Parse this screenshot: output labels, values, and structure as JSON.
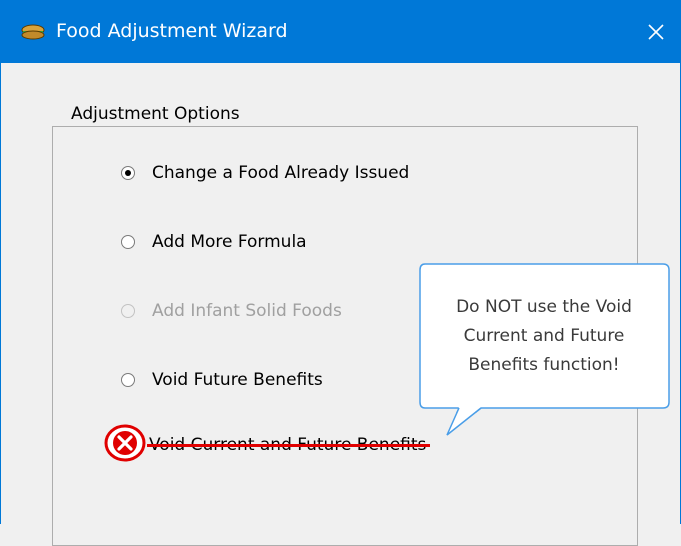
{
  "window": {
    "title": "Food Adjustment Wizard",
    "close_glyph": "✕",
    "icon": "app-icon"
  },
  "group": {
    "legend": "Adjustment Options"
  },
  "options": [
    {
      "label": "Change a Food Already Issued",
      "checked": true,
      "enabled": true
    },
    {
      "label": "Add More Formula",
      "checked": false,
      "enabled": true
    },
    {
      "label": "Add Infant Solid Foods",
      "checked": false,
      "enabled": false
    },
    {
      "label": "Void Future Benefits",
      "checked": false,
      "enabled": true
    }
  ],
  "void_option": {
    "label": "Void Current and Future Benefits",
    "icon": "red-x-icon"
  },
  "callout": {
    "lines": [
      "Do NOT use the Void",
      "Current and Future",
      "Benefits function!"
    ]
  },
  "colors": {
    "titlebar": "#0078d7",
    "warning": "#e00000",
    "callout_border": "#4a9ee8"
  }
}
